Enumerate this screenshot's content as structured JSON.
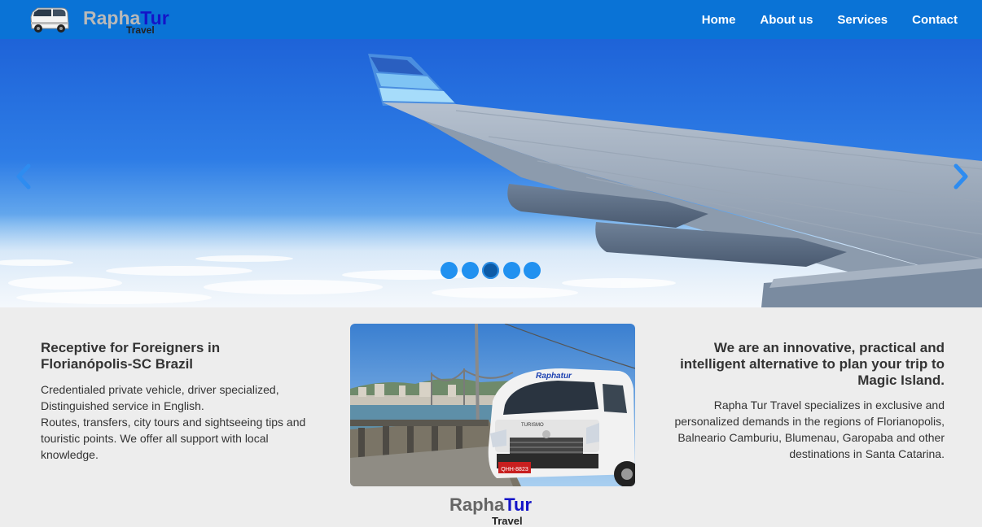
{
  "brand": {
    "name_part1": "Rapha",
    "name_part2": "Tur",
    "subtitle": "Travel"
  },
  "nav": {
    "items": [
      "Home",
      "About us",
      "Services",
      "Contact"
    ]
  },
  "slider": {
    "slide_count": 5,
    "active_index": 2,
    "prev_icon": "chevron-left-icon",
    "next_icon": "chevron-right-icon"
  },
  "left_column": {
    "heading_line1": "Receptive for Foreigners in",
    "heading_line2": "Florianópolis-SC Brazil",
    "line1": "Credentialed private vehicle, driver specialized,",
    "line2": "Distinguished service in English.",
    "line3": "Routes, transfers, city tours and sightseeing tips and touristic points. We offer all support with local knowledge."
  },
  "right_column": {
    "heading_line1": "We are an innovative, practical and",
    "heading_line2": "intelligent alternative to plan your trip to",
    "heading_line3": "Magic Island.",
    "body": "Rapha Tur Travel specializes in exclusive and personalized demands in the regions of Florianopolis, Balneario Camburiu, Blumenau, Garopaba and other destinations in Santa Catarina."
  },
  "photo": {
    "van_lettering": "Raphatur",
    "side_text": "TURISMO",
    "plate": "QHH-8823"
  },
  "colors": {
    "navbar": "#0a73d6",
    "brand_blue": "#1414c8",
    "dot": "#2191f0",
    "dot_active": "#0c5aa6"
  }
}
